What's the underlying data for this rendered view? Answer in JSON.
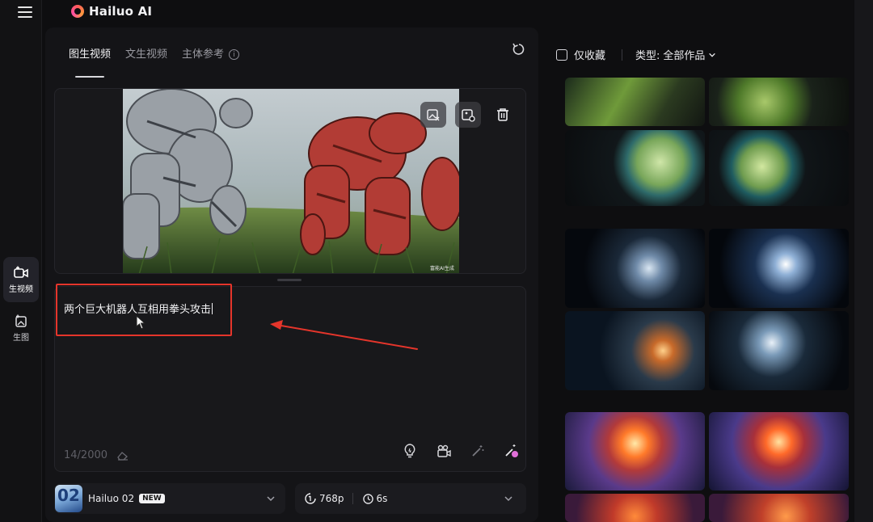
{
  "brand": {
    "name": "Hailuo AI"
  },
  "rail": {
    "items": [
      {
        "label": "生视频",
        "icon": "video-add-icon",
        "active": true
      },
      {
        "label": "生图",
        "icon": "image-add-icon",
        "active": false
      }
    ]
  },
  "tabs": [
    {
      "label": "图生视频",
      "active": true
    },
    {
      "label": "文生视频",
      "active": false
    },
    {
      "label": "主体参考",
      "active": false
    }
  ],
  "image_panel": {
    "watermark": "富能AI生成",
    "tools": [
      "image-replace-icon",
      "image-edit-icon",
      "trash-icon"
    ]
  },
  "prompt": {
    "text": "两个巨大机器人互相用拳头攻击",
    "counter": "14/2000"
  },
  "model": {
    "name": "Hailuo 02",
    "badge": "NEW",
    "thumb_text": "02"
  },
  "settings": {
    "resolution": "768p",
    "duration": "6s"
  },
  "gallery": {
    "favorite_label": "仅收藏",
    "type_label": "类型:",
    "type_value": "全部作品"
  },
  "colors": {
    "highlight": "#e5352b",
    "background": "#0e0e10",
    "panel": "#141417"
  }
}
